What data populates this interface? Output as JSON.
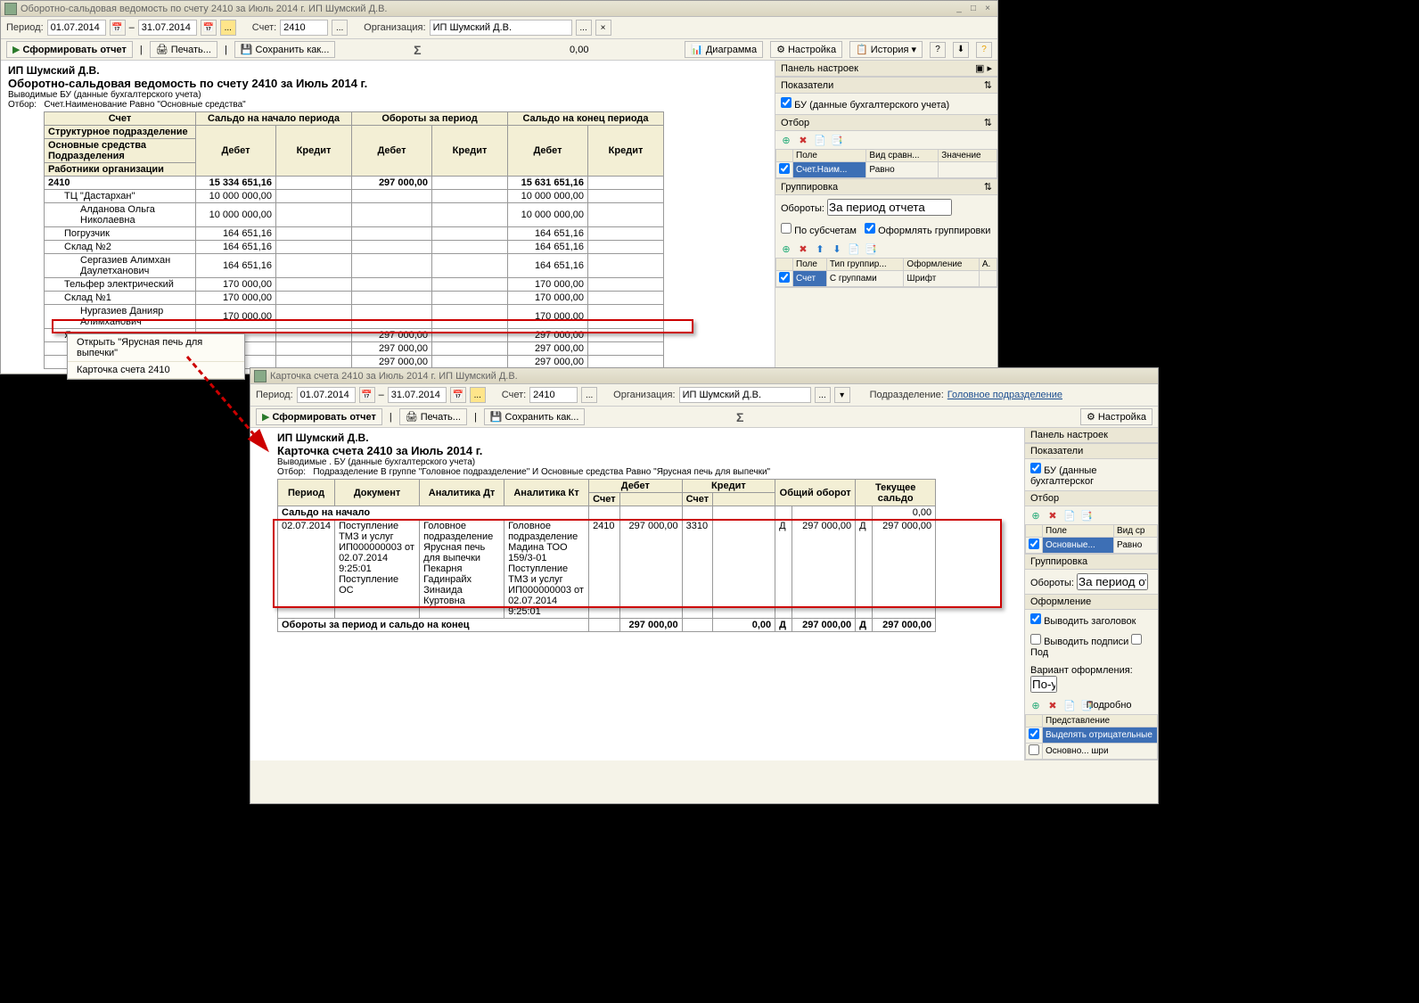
{
  "win1": {
    "title": "Оборотно-сальдовая ведомость по счету 2410 за Июль 2014 г. ИП Шумский Д.В.",
    "params": {
      "period_lbl": "Период:",
      "date_from": "01.07.2014",
      "date_to": "31.07.2014",
      "account_lbl": "Счет:",
      "account": "2410",
      "org_lbl": "Организация:",
      "org": "ИП Шумский Д.В."
    },
    "toolbar": {
      "run": "Сформировать отчет",
      "print": "Печать...",
      "save": "Сохранить как...",
      "sigma_val": "0,00",
      "chart": "Диаграмма",
      "setup": "Настройка",
      "history": "История"
    },
    "report": {
      "org": "ИП Шумский Д.В.",
      "title": "Оборотно-сальдовая ведомость по счету 2410 за Июль 2014 г.",
      "info1": "Выводимые БУ (данные бухгалтерского учета)",
      "info2_lbl": "Отбор:",
      "info2": "Счет.Наименование Равно \"Основные средства\"",
      "headers": {
        "acct": "Счет",
        "start": "Сальдо на начало периода",
        "turn": "Обороты за период",
        "end": "Сальдо на конец периода",
        "struct": "Структурное подразделение",
        "os": "Основные средства",
        "div": "Подразделения",
        "emp": "Работники организации",
        "dt": "Дебет",
        "kt": "Кредит"
      },
      "rows": [
        {
          "label": "2410",
          "d1": "15 334 651,16",
          "d2": "",
          "d3": "297 000,00",
          "d4": "",
          "d5": "15 631 651,16",
          "d6": ""
        },
        {
          "label": "ТЦ \"Дастархан\"",
          "d1": "10 000 000,00",
          "d5": "10 000 000,00",
          "indent": 1
        },
        {
          "label": "Алданова Ольга Николаевна",
          "d1": "10 000 000,00",
          "d5": "10 000 000,00",
          "indent": 2
        },
        {
          "label": "Погрузчик",
          "d1": "164 651,16",
          "d5": "164 651,16",
          "indent": 1
        },
        {
          "label": "Склад №2",
          "d1": "164 651,16",
          "d5": "164 651,16",
          "indent": 1
        },
        {
          "label": "Сергазиев Алимхан Даулетханович",
          "d1": "164 651,16",
          "d5": "164 651,16",
          "indent": 2
        },
        {
          "label": "Тельфер электрический",
          "d1": "170 000,00",
          "d5": "170 000,00",
          "indent": 1
        },
        {
          "label": "Склад №1",
          "d1": "170 000,00",
          "d5": "170 000,00",
          "indent": 1
        },
        {
          "label": "Нургазиев Данияр Алимханович",
          "d1": "170 000,00",
          "d5": "170 000,00",
          "indent": 2
        },
        {
          "label": "Ярусная печь для выпечки",
          "d3": "297 000,00",
          "d5": "297 000,00",
          "indent": 1,
          "hl": true
        },
        {
          "label": "",
          "d3": "297 000,00",
          "d5": "297 000,00",
          "indent": 1
        },
        {
          "label": "",
          "d3": "297 000,00",
          "d5": "297 000,00",
          "indent": 1
        }
      ]
    },
    "ctx": {
      "item1": "Открыть \"Ярусная печь для выпечки\"",
      "item2": "Карточка счета 2410"
    },
    "side": {
      "panel_title": "Панель настроек",
      "indicators": "Показатели",
      "bu": "БУ (данные бухгалтерского учета)",
      "filter": "Отбор",
      "f_field": "Поле",
      "f_cmp": "Вид сравн...",
      "f_val": "Значение",
      "f_row_field": "Счет.Наим...",
      "f_row_cmp": "Равно",
      "group": "Группировка",
      "turn_lbl": "Обороты:",
      "turn_val": "За период отчета",
      "by_sub": "По субсчетам",
      "grp_fmt": "Оформлять группировки",
      "g_field": "Поле",
      "g_type": "Тип группир...",
      "g_fmt": "Оформление",
      "g_a": "А.",
      "g_row_field": "Счет",
      "g_row_type": "С группами",
      "g_row_fmt": "Шрифт"
    }
  },
  "win2": {
    "title": "Карточка счета 2410 за Июль 2014 г. ИП Шумский Д.В.",
    "params": {
      "period_lbl": "Период:",
      "date_from": "01.07.2014",
      "date_to": "31.07.2014",
      "account_lbl": "Счет:",
      "account": "2410",
      "org_lbl": "Организация:",
      "org": "ИП Шумский Д.В.",
      "div_lbl": "Подразделение:",
      "div": "Головное подразделение"
    },
    "toolbar": {
      "run": "Сформировать отчет",
      "print": "Печать...",
      "save": "Сохранить как...",
      "setup": "Настройка"
    },
    "report": {
      "org": "ИП Шумский Д.В.",
      "title": "Карточка счета 2410 за Июль 2014 г.",
      "info1": "Выводимые . БУ (данные бухгалтерского учета)",
      "info2_lbl": "Отбор:",
      "info2": "Подразделение В группе \"Головное подразделение\" И Основные средства Равно \"Ярусная печь для выпечки\"",
      "headers": {
        "period": "Период",
        "doc": "Документ",
        "an_dt": "Аналитика Дт",
        "an_kt": "Аналитика Кт",
        "dt": "Дебет",
        "kt": "Кредит",
        "acct": "Счет",
        "total": "Общий оборот",
        "balance": "Текущее сальдо"
      },
      "start_lbl": "Сальдо на начало",
      "start_val": "0,00",
      "row": {
        "period": "02.07.2014",
        "doc": "Поступление ТМЗ и услуг ИП000000003 от 02.07.2014 9:25:01\nПоступление ОС",
        "an_dt": "Головное подразделение\nЯрусная печь для выпечки\nПекарня\nГадинрайх Зинаида Куртовна",
        "an_kt": "Головное подразделение\nМадина ТОО\n159/3-01\nПоступление ТМЗ и услуг ИП000000003 от 02.07.2014 9:25:01",
        "dt_acct": "2410",
        "dt_val": "297 000,00",
        "kt_acct": "3310",
        "kt_val": "",
        "total_dk": "Д",
        "total": "297 000,00",
        "bal_dk": "Д",
        "bal": "297 000,00"
      },
      "end_lbl": "Обороты за период и сальдо на конец",
      "end_dt": "297 000,00",
      "end_kt": "0,00",
      "end_total_dk": "Д",
      "end_total": "297 000,00",
      "end_bal_dk": "Д",
      "end_bal": "297 000,00"
    },
    "side": {
      "panel_title": "Панель настроек",
      "indicators": "Показатели",
      "bu": "БУ (данные бухгалтерског",
      "filter": "Отбор",
      "f_field": "Поле",
      "f_cmp": "Вид ср",
      "f_row_field": "Основные...",
      "f_row_cmp": "Равно",
      "group": "Группировка",
      "turn_lbl": "Обороты:",
      "turn_val": "За период отчета",
      "design": "Оформление",
      "show_hdr": "Выводить заголовок",
      "show_sign": "Выводить подписи",
      "show_sub": "Под",
      "variant_lbl": "Вариант оформления:",
      "variant_val": "По-у",
      "more": "Подробно",
      "repr": "Представление",
      "neg": "Выделять отрицательные",
      "font": "Основно... шри"
    }
  }
}
